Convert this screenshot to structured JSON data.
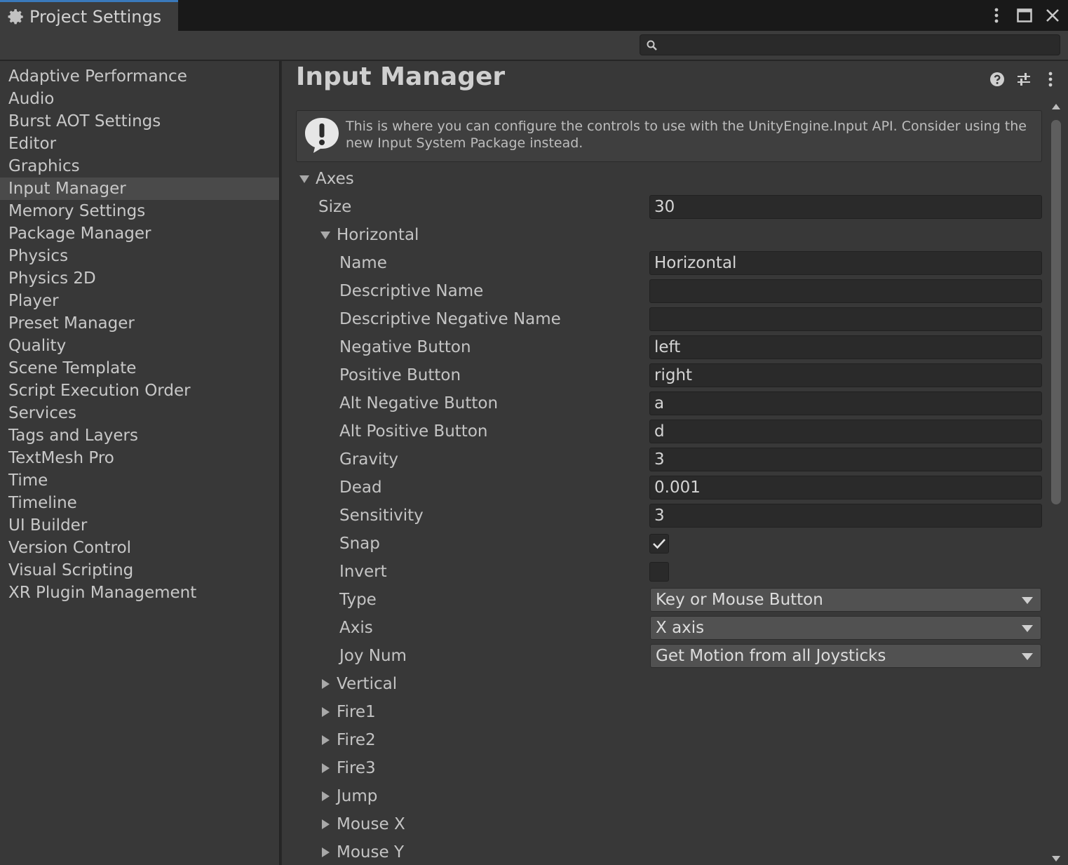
{
  "window": {
    "tab_title": "Project Settings"
  },
  "search": {
    "value": "",
    "placeholder": ""
  },
  "sidebar": {
    "items": [
      {
        "label": "Adaptive Performance"
      },
      {
        "label": "Audio"
      },
      {
        "label": "Burst AOT Settings"
      },
      {
        "label": "Editor"
      },
      {
        "label": "Graphics"
      },
      {
        "label": "Input Manager",
        "selected": true
      },
      {
        "label": "Memory Settings"
      },
      {
        "label": "Package Manager"
      },
      {
        "label": "Physics"
      },
      {
        "label": "Physics 2D"
      },
      {
        "label": "Player"
      },
      {
        "label": "Preset Manager"
      },
      {
        "label": "Quality"
      },
      {
        "label": "Scene Template"
      },
      {
        "label": "Script Execution Order"
      },
      {
        "label": "Services"
      },
      {
        "label": "Tags and Layers"
      },
      {
        "label": "TextMesh Pro"
      },
      {
        "label": "Time"
      },
      {
        "label": "Timeline"
      },
      {
        "label": "UI Builder"
      },
      {
        "label": "Version Control"
      },
      {
        "label": "Visual Scripting"
      },
      {
        "label": "XR Plugin Management"
      }
    ]
  },
  "main": {
    "title": "Input Manager",
    "help_text": "This is where you can configure the controls to use with the UnityEngine.Input API. Consider using the new Input System Package instead.",
    "axes_label": "Axes",
    "size_label": "Size",
    "size_value": "30",
    "horizontal": {
      "label": "Horizontal",
      "fields": [
        {
          "label": "Name",
          "value": "Horizontal"
        },
        {
          "label": "Descriptive Name",
          "value": ""
        },
        {
          "label": "Descriptive Negative Name",
          "value": ""
        },
        {
          "label": "Negative Button",
          "value": "left"
        },
        {
          "label": "Positive Button",
          "value": "right"
        },
        {
          "label": "Alt Negative Button",
          "value": "a"
        },
        {
          "label": "Alt Positive Button",
          "value": "d"
        },
        {
          "label": "Gravity",
          "value": "3"
        },
        {
          "label": "Dead",
          "value": "0.001"
        },
        {
          "label": "Sensitivity",
          "value": "3"
        }
      ],
      "snap_label": "Snap",
      "snap_checked": true,
      "invert_label": "Invert",
      "invert_checked": false,
      "type_label": "Type",
      "type_value": "Key or Mouse Button",
      "axis_label": "Axis",
      "axis_value": "X axis",
      "joynum_label": "Joy Num",
      "joynum_value": "Get Motion from all Joysticks"
    },
    "collapsed_axes": [
      "Vertical",
      "Fire1",
      "Fire2",
      "Fire3",
      "Jump",
      "Mouse X",
      "Mouse Y"
    ]
  },
  "icons": {
    "tab": "gear-icon",
    "window": [
      "kebab-menu-icon",
      "maximize-icon",
      "close-icon"
    ],
    "search": "search-icon",
    "title": [
      "help-icon",
      "preset-sliders-icon",
      "kebab-menu-icon"
    ],
    "help": "warning-icon"
  },
  "colors": {
    "background": "#383838",
    "selected": "#4a4a4a",
    "tab_accent": "#3a79bb",
    "field": "#2a2a2a",
    "dropdown": "#515151"
  }
}
